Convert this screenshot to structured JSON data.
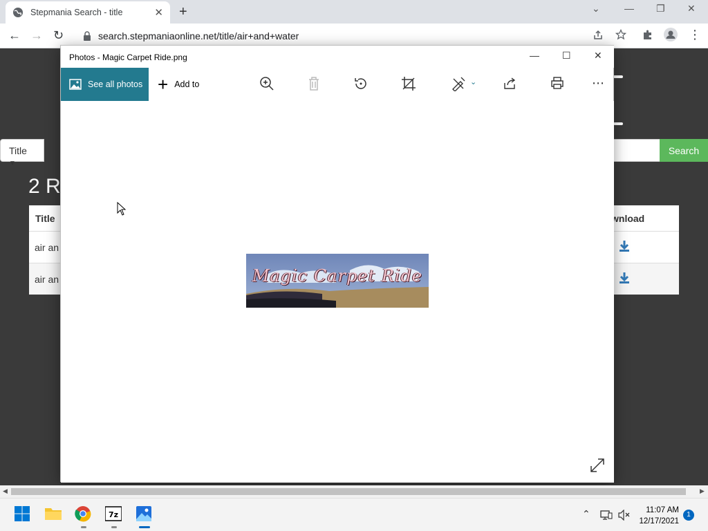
{
  "browser": {
    "tab_title": "Stepmania Search - title",
    "url": "search.stepmaniaonline.net/title/air+and+water"
  },
  "page": {
    "search_field_dropdown": "Title",
    "search_button": "Search",
    "results_heading": "2 R",
    "table": {
      "col_title": "Title",
      "col_download": "wnload",
      "rows": [
        {
          "title": "air an"
        },
        {
          "title": "air an"
        }
      ]
    }
  },
  "photos_app": {
    "window_title": "Photos - Magic Carpet Ride.png",
    "see_all_label": "See all photos",
    "add_to_label": "Add to",
    "image_text": "Magic Carpet Ride"
  },
  "taskbar": {
    "time": "11:07 AM",
    "date": "12/17/2021",
    "notification_count": "1"
  },
  "colors": {
    "photos_accent": "#237a8f",
    "search_button": "#5cb85c",
    "download_icon": "#337ab7"
  }
}
